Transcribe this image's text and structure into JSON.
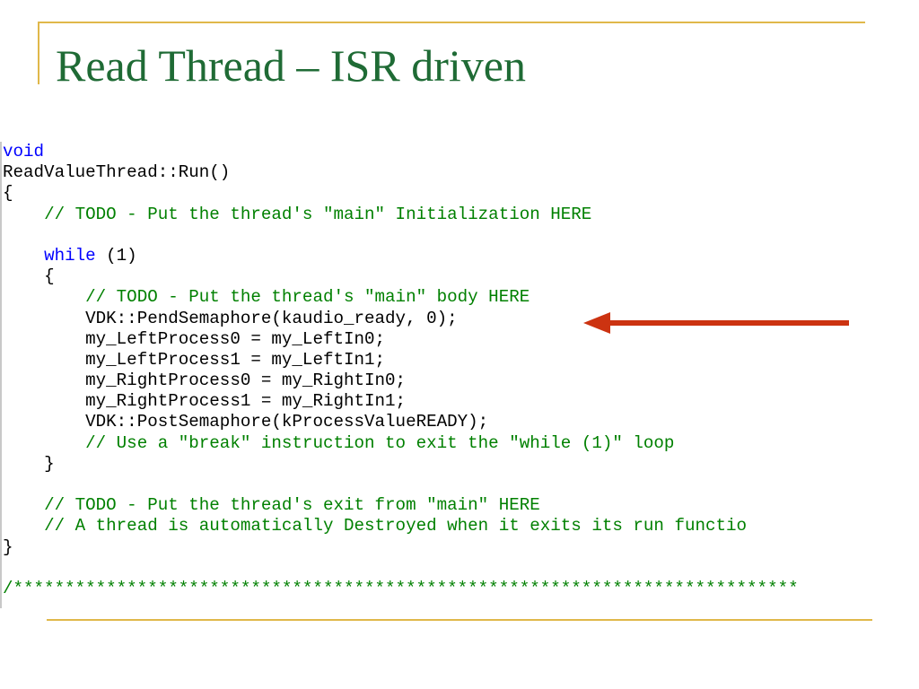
{
  "slide": {
    "title": "Read Thread – ISR driven"
  },
  "code": {
    "lines": [
      {
        "indent": "",
        "keyword": "void",
        "text": "",
        "comment": ""
      },
      {
        "indent": "",
        "keyword": "",
        "text": "ReadValueThread::Run()",
        "comment": ""
      },
      {
        "indent": "",
        "keyword": "",
        "text": "{",
        "comment": ""
      },
      {
        "indent": "    ",
        "keyword": "",
        "text": "",
        "comment": "// TODO - Put the thread's \"main\" Initialization HERE"
      },
      {
        "indent": "",
        "keyword": "",
        "text": "",
        "comment": ""
      },
      {
        "indent": "    ",
        "keyword": "while",
        "text": " (1)",
        "comment": ""
      },
      {
        "indent": "    ",
        "keyword": "",
        "text": "{",
        "comment": ""
      },
      {
        "indent": "        ",
        "keyword": "",
        "text": "",
        "comment": "// TODO - Put the thread's \"main\" body HERE"
      },
      {
        "indent": "        ",
        "keyword": "",
        "text": "VDK::PendSemaphore(kaudio_ready, 0);",
        "comment": ""
      },
      {
        "indent": "        ",
        "keyword": "",
        "text": "my_LeftProcess0 = my_LeftIn0;",
        "comment": ""
      },
      {
        "indent": "        ",
        "keyword": "",
        "text": "my_LeftProcess1 = my_LeftIn1;",
        "comment": ""
      },
      {
        "indent": "        ",
        "keyword": "",
        "text": "my_RightProcess0 = my_RightIn0;",
        "comment": ""
      },
      {
        "indent": "        ",
        "keyword": "",
        "text": "my_RightProcess1 = my_RightIn1;",
        "comment": ""
      },
      {
        "indent": "        ",
        "keyword": "",
        "text": "VDK::PostSemaphore(kProcessValueREADY);",
        "comment": ""
      },
      {
        "indent": "        ",
        "keyword": "",
        "text": "",
        "comment": "// Use a \"break\" instruction to exit the \"while (1)\" loop"
      },
      {
        "indent": "    ",
        "keyword": "",
        "text": "}",
        "comment": ""
      },
      {
        "indent": "",
        "keyword": "",
        "text": "",
        "comment": ""
      },
      {
        "indent": "    ",
        "keyword": "",
        "text": "",
        "comment": "// TODO - Put the thread's exit from \"main\" HERE"
      },
      {
        "indent": "    ",
        "keyword": "",
        "text": "",
        "comment": "// A thread is automatically Destroyed when it exits its run functio"
      },
      {
        "indent": "",
        "keyword": "",
        "text": "}",
        "comment": ""
      },
      {
        "indent": "",
        "keyword": "",
        "text": "",
        "comment": ""
      },
      {
        "indent": "",
        "keyword": "",
        "text": "",
        "comment": "/****************************************************************************"
      }
    ]
  },
  "annotation": {
    "arrow_icon": "left-arrow-icon",
    "target_line": 8
  },
  "colors": {
    "title": "#1f6b35",
    "frame": "#e0b84a",
    "keyword": "#0000ff",
    "comment": "#008000",
    "arrow": "#cc3311"
  }
}
